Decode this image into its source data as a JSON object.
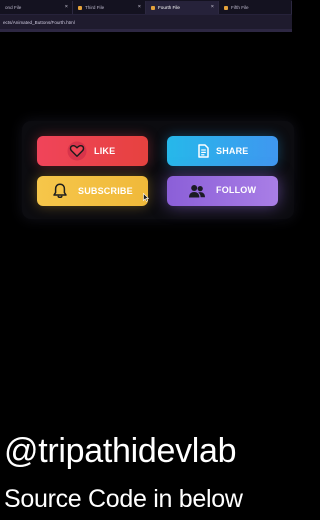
{
  "browser": {
    "tabs": [
      {
        "label": "ond File",
        "active": false
      },
      {
        "label": "Third File",
        "active": false
      },
      {
        "label": "Fourth File",
        "active": true
      },
      {
        "label": "Fifth File",
        "active": false
      }
    ],
    "path": "ects/Animated_Buttons/Fourth.html"
  },
  "buttons": {
    "like": {
      "label": "LIKE",
      "icon": "heart-icon",
      "color": "#f0445a"
    },
    "share": {
      "label": "SHARE",
      "icon": "document-icon",
      "color": "#26b8ea"
    },
    "subscribe": {
      "label": "SUBSCRIBE",
      "icon": "bell-icon",
      "color": "#f6c64a"
    },
    "follow": {
      "label": "FOLLOW",
      "icon": "users-icon",
      "color": "#8b5fd8"
    }
  },
  "overlay": {
    "handle": "@tripathidevlab",
    "source": "Source Code in below"
  }
}
